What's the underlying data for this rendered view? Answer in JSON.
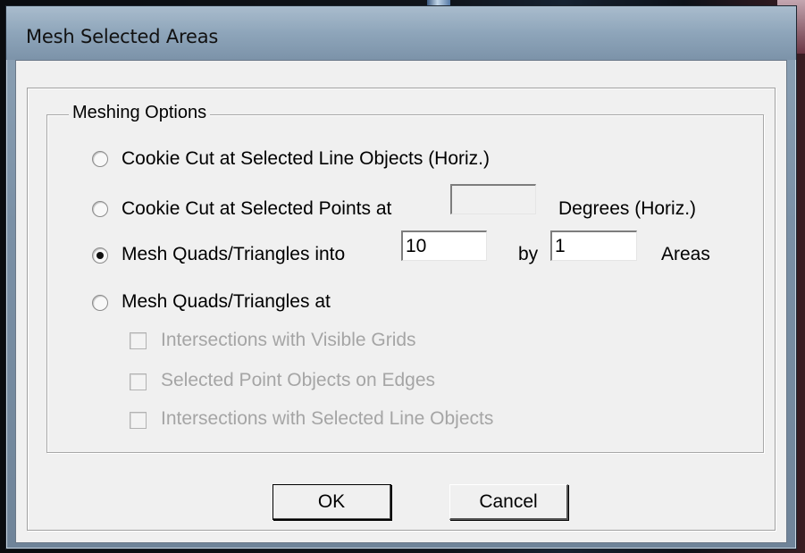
{
  "dialog": {
    "title": "Mesh Selected Areas"
  },
  "meshing_options": {
    "legend": "Meshing Options",
    "options": [
      {
        "label": "Cookie Cut at Selected Line Objects (Horiz.)",
        "checked": false
      },
      {
        "label": "Cookie Cut at Selected Points at",
        "suffix": "Degrees (Horiz.)",
        "value": "",
        "checked": false
      },
      {
        "label": "Mesh Quads/Triangles into",
        "value1": "10",
        "by_label": "by",
        "value2": "1",
        "suffix": "Areas",
        "checked": true
      },
      {
        "label": "Mesh Quads/Triangles at",
        "checked": false
      }
    ],
    "sub_options": [
      {
        "label": "Intersections with Visible Grids",
        "checked": false,
        "enabled": false
      },
      {
        "label": "Selected Point Objects on Edges",
        "checked": false,
        "enabled": false
      },
      {
        "label": "Intersections with Selected Line Objects",
        "checked": false,
        "enabled": false
      }
    ]
  },
  "buttons": {
    "ok": "OK",
    "cancel": "Cancel"
  }
}
